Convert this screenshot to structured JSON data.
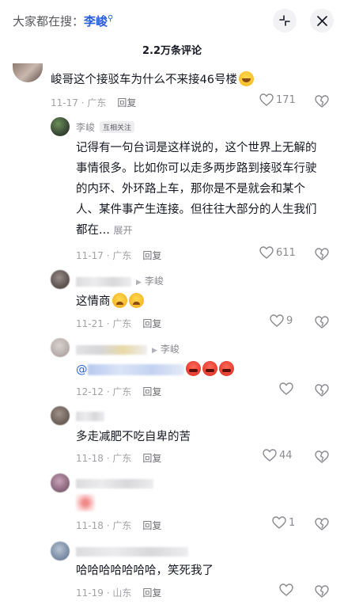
{
  "header": {
    "search_prefix": "大家都在搜：",
    "search_keyword": "李峻",
    "collapse_icon": "collapse-icon",
    "close_icon": "close-icon"
  },
  "comment_count": "2.2万条评论",
  "reply_label": "回复",
  "comments": [
    {
      "text": "峻哥这个接驳车为什么不来接46号楼",
      "emoji": "grin",
      "date": "11-17",
      "location": "广东",
      "likes": "171"
    },
    {
      "author": "李峻",
      "tag": "互相关注",
      "text": "记得有一句台词是这样说的，这个世界上无解的事情很多。比如你可以走多两步路到接驳车行驶的内环、外环路上车，那你是不是就会和某个人、某件事产生连接。但往往大部分的人生我们都在...",
      "expand": "展开",
      "date": "11-17",
      "location": "广东",
      "likes": "611"
    },
    {
      "reply_to": "李峻",
      "text": "这情商",
      "emoji": "cry",
      "date": "11-21",
      "location": "广东",
      "likes": "9"
    },
    {
      "reply_to": "李峻",
      "mention_prefix": "@",
      "emoji": "angry",
      "date": "12-12",
      "location": "广东",
      "likes": ""
    },
    {
      "text": "多走减肥不吃自卑的苦",
      "date": "11-18",
      "location": "广东",
      "likes": "44"
    },
    {
      "date": "11-18",
      "location": "广东",
      "likes": "1"
    },
    {
      "text": "哈哈哈哈哈哈哈，笑死我了",
      "date": "11-19",
      "location": "山东",
      "likes": ""
    }
  ],
  "colors": {
    "keyword": "#2b5fd9",
    "text": "#161823",
    "meta": "#a1a2a7"
  }
}
